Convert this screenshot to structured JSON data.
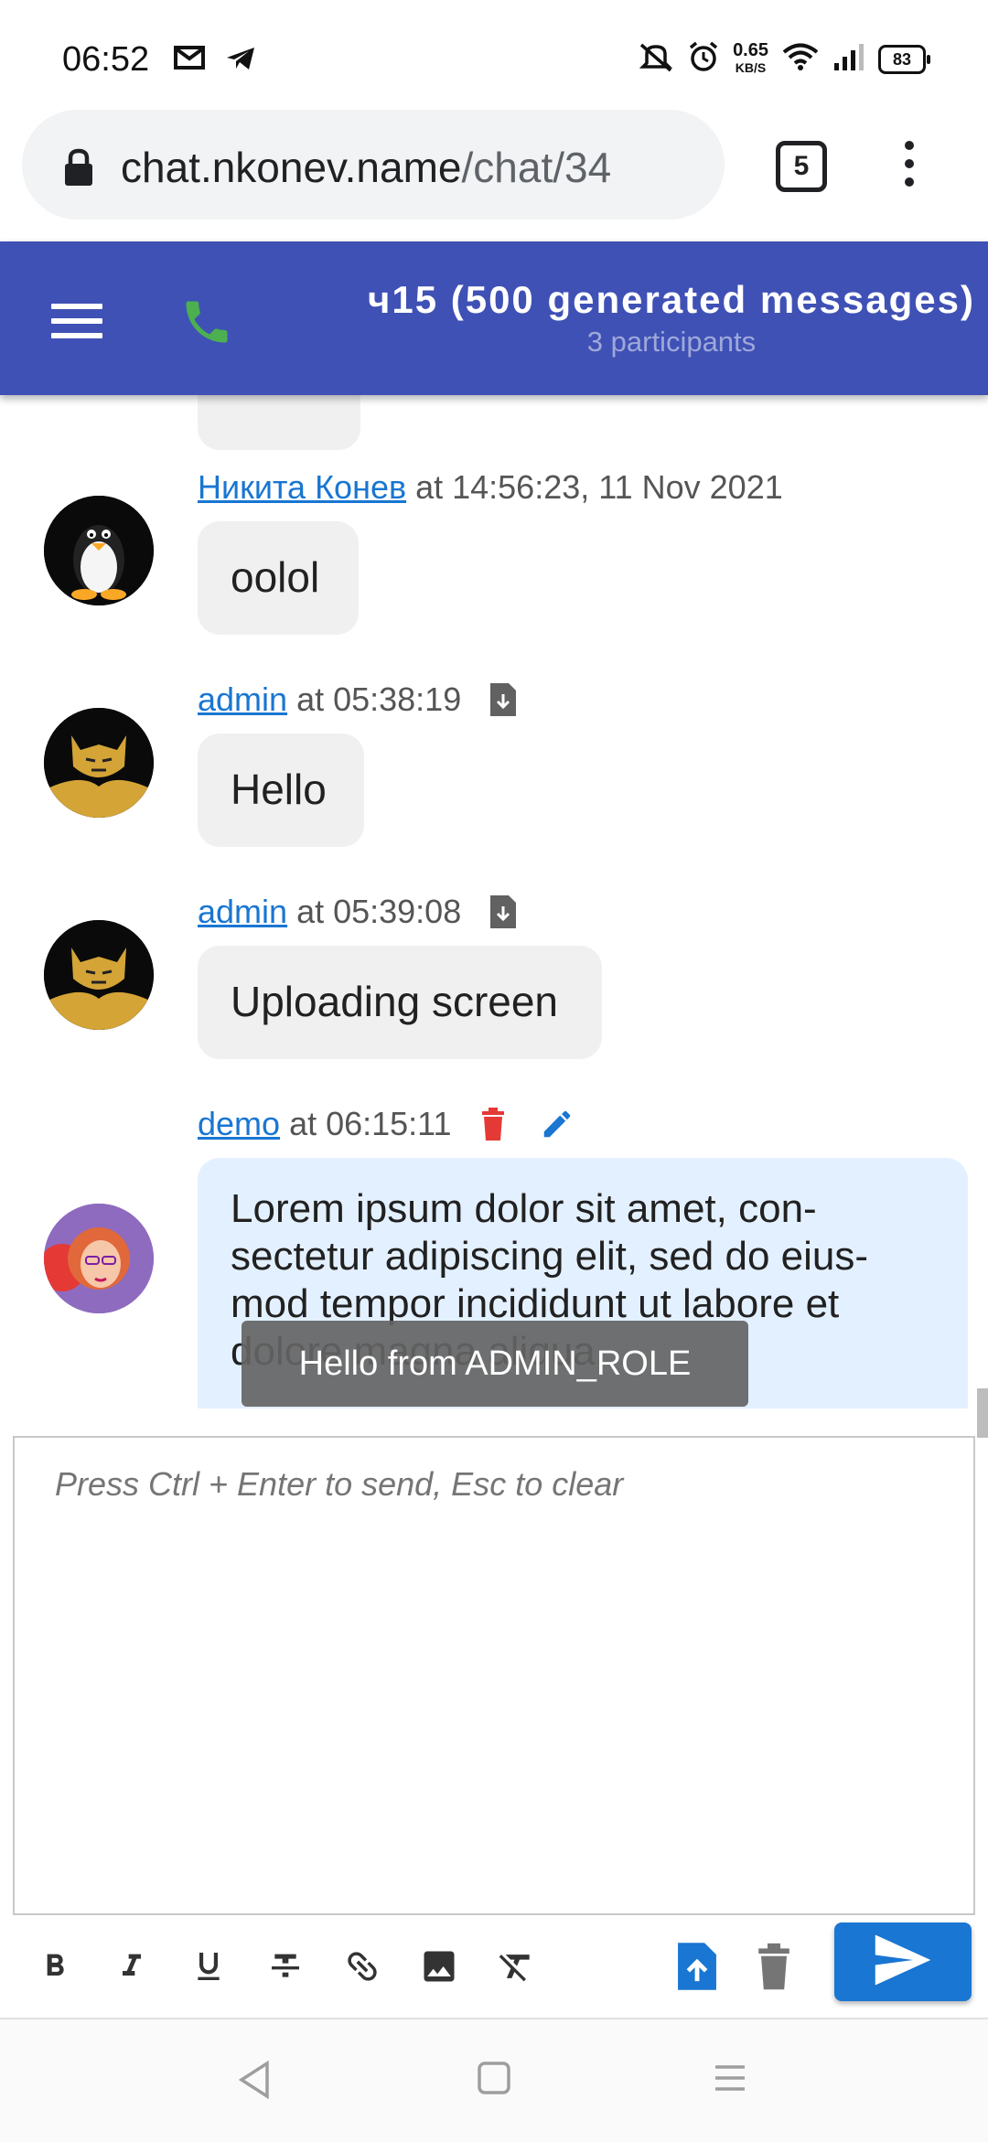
{
  "status_bar": {
    "time": "06:52",
    "net_speed_value": "0.65",
    "net_speed_unit": "KB/S",
    "battery": "83",
    "icons": [
      "gmail-icon",
      "telegram-icon",
      "mute-icon",
      "alarm-icon",
      "wifi-icon",
      "signal-icon",
      "battery-icon"
    ]
  },
  "browser": {
    "url_host": "chat.nkonev.name",
    "url_path": "/chat/34",
    "tab_count": "5"
  },
  "app_bar": {
    "title": "ч15 (500 generated messages)",
    "subtitle": "3 participants",
    "accent_color": "#3f51b5",
    "phone_color": "#4caf50"
  },
  "messages": [
    {
      "author": "Никита Конев",
      "time": "at 14:56:23, 11 Nov 2021",
      "text": "oolol",
      "avatar": "linux-penguin-avatar"
    },
    {
      "author": "admin",
      "time": "at 05:38:19",
      "text": "Hello",
      "avatar": "tomcat-avatar",
      "has_download": true
    },
    {
      "author": "admin",
      "time": "at 05:39:08",
      "text": "Uploading screen",
      "avatar": "tomcat-avatar",
      "has_download": true
    },
    {
      "author": "demo",
      "time": "at 06:15:11",
      "text": "Lorem ipsum dolor sit amet, con-sectetur adipiscing elit, sed do eius-mod tempor incididunt ut labore et dolore magna aliqua.",
      "avatar": "demo-user-avatar",
      "own": true
    }
  ],
  "snackbar": {
    "text": "Hello from ADMIN_ROLE"
  },
  "editor": {
    "placeholder": "Press Ctrl + Enter to send, Esc to clear"
  },
  "toolbar": {
    "buttons": [
      "bold-icon",
      "italic-icon",
      "underline-icon",
      "strikethrough-icon",
      "link-icon",
      "image-icon",
      "clear-format-icon",
      "upload-file-icon",
      "trash-icon",
      "send-icon"
    ],
    "send_color": "#1976d2"
  }
}
